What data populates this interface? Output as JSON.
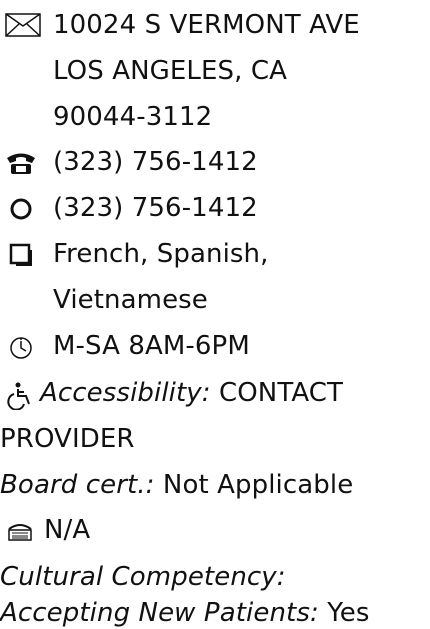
{
  "provider_details": {
    "address": {
      "icon": "mail-icon",
      "line1": "10024 S VERMONT AVE",
      "line2": "LOS ANGELES, CA",
      "line3": "90044-3112"
    },
    "phone": {
      "icon": "telephone-icon",
      "value": "(323) 756-1412"
    },
    "alt_phone": {
      "icon": "circle-icon",
      "value": "(323) 756-1412"
    },
    "languages": {
      "icon": "square-icon",
      "line1": "French,  Spanish,",
      "line2": "Vietnamese"
    },
    "hours": {
      "icon": "clock-icon",
      "value": "M-SA 8AM-6PM"
    },
    "accessibility": {
      "icon": "wheelchair-icon",
      "label": "Accessibility:",
      "value_line1": "CONTACT",
      "value_line2": "PROVIDER"
    },
    "board_cert": {
      "label": "Board cert.:",
      "value": "Not Applicable"
    },
    "fax": {
      "icon": "fax-icon",
      "value": "N/A"
    },
    "cultural_competency": {
      "label": "Cultural Competency:"
    },
    "accepting_new_patients": {
      "label": "Accepting New Patients:",
      "value": "Yes"
    }
  }
}
